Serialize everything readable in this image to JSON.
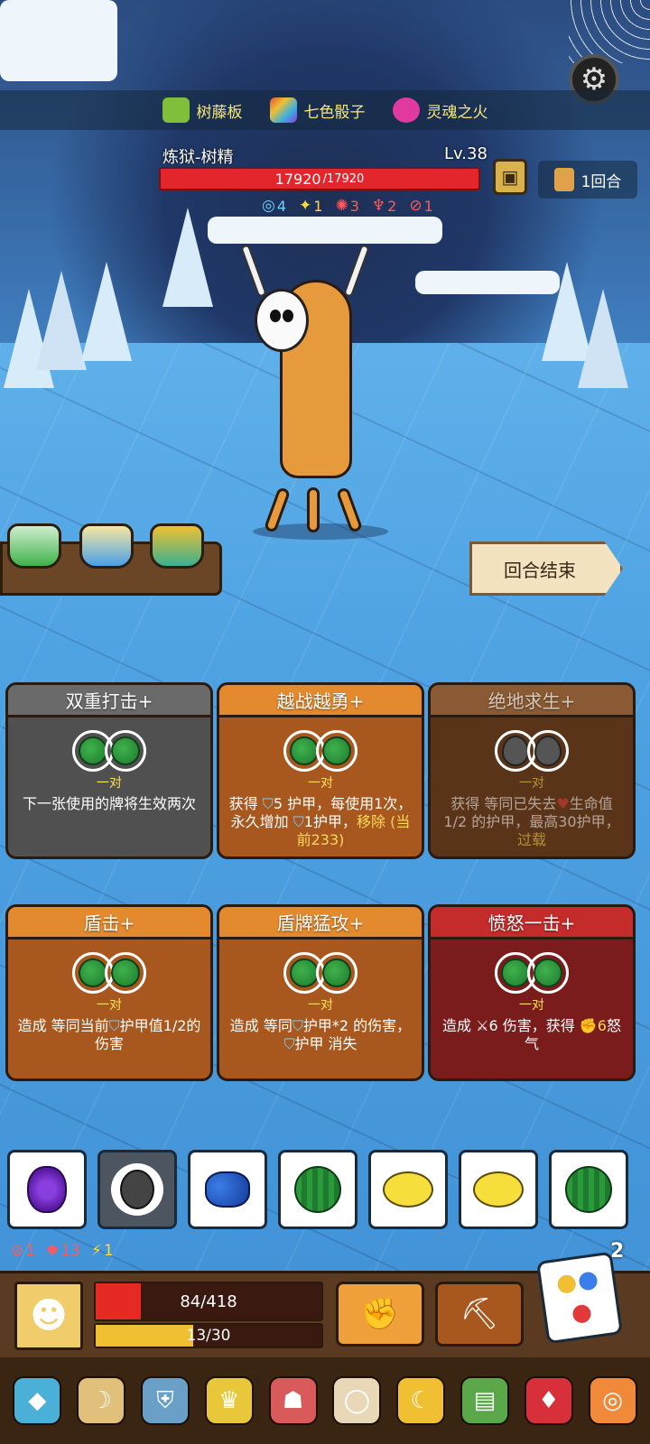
{
  "relics_top": [
    {
      "name": "树藤板",
      "icon": "vine-board-icon",
      "color": "#7fbf3a"
    },
    {
      "name": "七色骰子",
      "icon": "rainbow-dice-icon",
      "color": "#e0503a"
    },
    {
      "name": "灵魂之火",
      "icon": "soul-fire-icon",
      "color": "#e03aa0"
    }
  ],
  "enemy": {
    "name": "炼狱-树精",
    "level": "Lv.38",
    "hp_current": "17920",
    "hp_max": " /17920",
    "hp_fraction": 1.0,
    "stats": {
      "shield": "4",
      "star": "1",
      "rage": "3",
      "claw": "2",
      "attack": "1"
    }
  },
  "round": {
    "label": "1回合"
  },
  "end_turn_label": "回合结束",
  "cards": [
    {
      "title": "双重打击+",
      "req": "一对",
      "desc": "下一张使用的牌将生效两次",
      "theme": "grey"
    },
    {
      "title": "越战越勇+",
      "req": "一对",
      "desc_a": "获得 ",
      "desc_b": "5",
      "desc_c": " 护甲，每使用1次，永久增加 ",
      "desc_d": "1",
      "desc_e": "护甲，",
      "desc_hl1": "移除",
      "desc_hl2": " (当前233)",
      "theme": "orange"
    },
    {
      "title": "绝地求生+",
      "req": "一对",
      "desc_a": "获得 等同已失去",
      "desc_b": "生命值1/2 的护甲，最高30护甲，",
      "desc_hl": "过载",
      "theme": "brown"
    },
    {
      "title": "盾击+",
      "req": "一对",
      "desc_a": "造成 等同当前",
      "desc_b": "护甲值1/2的伤害",
      "theme": "orange"
    },
    {
      "title": "盾牌猛攻+",
      "req": "一对",
      "desc_a": "造成 等同",
      "desc_b": "护甲*2 的伤害，",
      "desc_c": "护甲 消失",
      "theme": "orange"
    },
    {
      "title": "愤怒一击+",
      "req": "一对",
      "desc_a": "造成 ",
      "desc_b": "6 伤害，获得 ",
      "desc_c": "6",
      "desc_d": "怒气",
      "theme": "red"
    }
  ],
  "dice": [
    {
      "face": "grape",
      "icon": "grape-icon"
    },
    {
      "face": "seed",
      "icon": "seed-icon",
      "selected": true
    },
    {
      "face": "blueberry",
      "icon": "blueberry-icon"
    },
    {
      "face": "watermelon",
      "icon": "watermelon-icon"
    },
    {
      "face": "lemon",
      "icon": "lemon-icon"
    },
    {
      "face": "lemon",
      "icon": "lemon-icon"
    },
    {
      "face": "watermelon",
      "icon": "watermelon-icon"
    }
  ],
  "player_stats": {
    "attack": "1",
    "gear": "13",
    "energy": "1"
  },
  "reroll_count": "2",
  "player": {
    "hp_text": "84/418",
    "hp_fraction": 0.2,
    "rage_text": "13/30",
    "rage_fraction": 0.433
  },
  "colors": {
    "enemy_hp": "#e2262b",
    "player_hp": "#e52a24",
    "rage": "#f0c032",
    "relic_text": "#f7e77a"
  }
}
